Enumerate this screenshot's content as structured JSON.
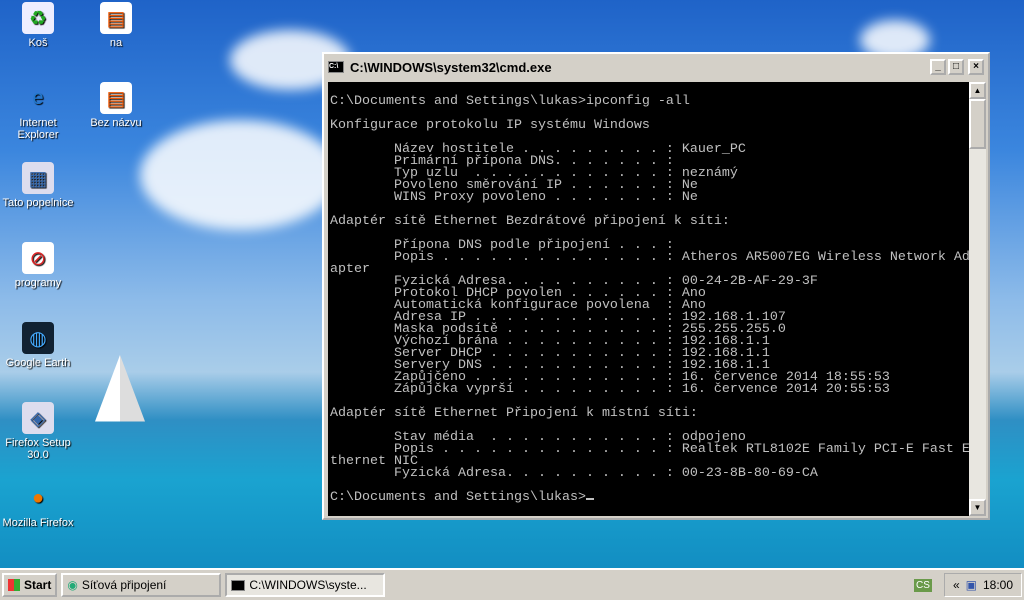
{
  "desktop_icons": [
    {
      "label": "Koš",
      "icon": "recycle-bin-icon"
    },
    {
      "label": "Internet Explorer",
      "icon": "internet-explorer-icon"
    },
    {
      "label": "Tato popelnice",
      "icon": "shortcut-icon"
    },
    {
      "label": "programy",
      "icon": "no-sign-icon"
    },
    {
      "label": "Google Earth",
      "icon": "google-earth-icon"
    },
    {
      "label": "Firefox Setup 30.0",
      "icon": "installer-icon"
    },
    {
      "label": "Mozilla Firefox",
      "icon": "firefox-icon"
    },
    {
      "label": "na",
      "icon": "document-icon"
    },
    {
      "label": "Bez názvu",
      "icon": "document-icon"
    }
  ],
  "window": {
    "title": "C:\\WINDOWS\\system32\\cmd.exe",
    "minimize": "_",
    "maximize": "□",
    "close": "×"
  },
  "console": {
    "lines": [
      "C:\\Documents and Settings\\lukas>ipconfig -all",
      "",
      "Konfigurace protokolu IP systému Windows",
      "",
      "        Název hostitele . . . . . . . . . : Kauer_PC",
      "        Primární přípona DNS. . . . . . . :",
      "        Typ uzlu  . . . . . . . . . . . . : neznámý",
      "        Povoleno směrování IP . . . . . . : Ne",
      "        WINS Proxy povoleno . . . . . . . : Ne",
      "",
      "Adaptér sítě Ethernet Bezdrátové připojení k síti:",
      "",
      "        Přípona DNS podle připojení . . . :",
      "        Popis . . . . . . . . . . . . . . : Atheros AR5007EG Wireless Network Ad",
      "apter",
      "        Fyzická Adresa. . . . . . . . . . : 00-24-2B-AF-29-3F",
      "        Protokol DHCP povolen . . . . . . : Ano",
      "        Automatická konfigurace povolena  : Ano",
      "        Adresa IP . . . . . . . . . . . . : 192.168.1.107",
      "        Maska podsítě . . . . . . . . . . : 255.255.255.0",
      "        Výchozí brána . . . . . . . . . . : 192.168.1.1",
      "        Server DHCP . . . . . . . . . . . : 192.168.1.1",
      "        Servery DNS . . . . . . . . . . . : 192.168.1.1",
      "        Zapůjčeno . . . . . . . . . . . . : 16. července 2014 18:55:53",
      "        Zápůjčka vyprší . . . . . . . . . : 16. července 2014 20:55:53",
      "",
      "Adaptér sítě Ethernet Připojení k místní síti:",
      "",
      "        Stav média  . . . . . . . . . . . : odpojeno",
      "        Popis . . . . . . . . . . . . . . : Realtek RTL8102E Family PCI-E Fast E",
      "thernet NIC",
      "        Fyzická Adresa. . . . . . . . . . : 00-23-8B-80-69-CA",
      "",
      "C:\\Documents and Settings\\lukas>"
    ]
  },
  "taskbar": {
    "start": "Start",
    "items": [
      {
        "label": "Síťová připojení"
      },
      {
        "label": "C:\\WINDOWS\\syste..."
      }
    ],
    "language": "CS",
    "tray_expand": "«",
    "clock": "18:00"
  }
}
